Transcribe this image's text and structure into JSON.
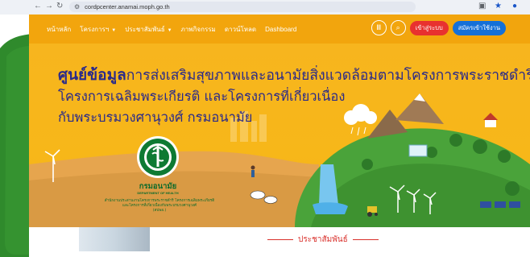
{
  "browser": {
    "url": "cordpcenter.anamai.moph.go.th"
  },
  "header": {
    "menu": [
      {
        "label": "หน้าหลัก",
        "has_dropdown": false
      },
      {
        "label": "โครงการฯ",
        "has_dropdown": true
      },
      {
        "label": "ประชาสัมพันธ์",
        "has_dropdown": true
      },
      {
        "label": "ภาพกิจกรรม",
        "has_dropdown": false
      },
      {
        "label": "ดาวน์โหลด",
        "has_dropdown": false
      },
      {
        "label": "Dashboard",
        "has_dropdown": false
      }
    ],
    "login_label": "เข้าสู่ระบบ",
    "register_label": "สมัครเข้าใช้งาน"
  },
  "hero": {
    "title_strong": "ศูนย์ข้อมูล",
    "title_rest": "การส่งเสริมสุขภาพและอนามัยสิ่งแวดล้อมตามโครงการพระราชดำริ",
    "title_line2": "โครงการเฉลิมพระเกียรติ และโครงการที่เกี่ยวเนื่อง",
    "title_line3": "กับพระบรมวงศานุวงศ์ กรมอนามัย",
    "department_name": "กรมอนามัย",
    "department_name_en": "DEPARTMENT OF HEALTH",
    "office_line1": "สำนักงานประสานงานโครงการพระราชดำริ โครงการเฉลิมพระเกียรติ",
    "office_line2": "และโครงการที่เกี่ยวเนื่องกับพระบรมวงศานุวงศ์",
    "office_line3": "(สปพอ.)"
  },
  "section": {
    "heading": "ประชาสัมพันธ์"
  },
  "colors": {
    "header_bg": "#f2a50d",
    "hero_bg": "#f7b51e",
    "title_text": "#2a2a8a",
    "frame_green": "#2f8a2c",
    "login_red": "#e8312f",
    "register_blue": "#1570d8",
    "section_red": "#d9302b"
  }
}
